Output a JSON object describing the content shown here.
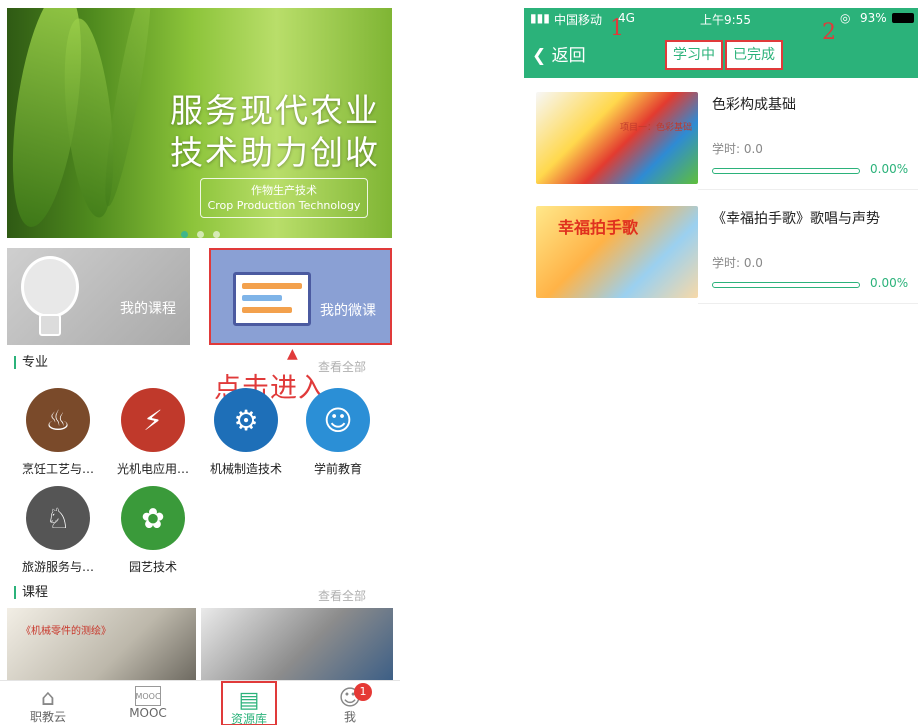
{
  "left_screen": {
    "banner": {
      "headline_line1": "服务现代农业",
      "headline_line2": "技术助力创收",
      "tag_line1": "作物生产技术",
      "tag_line2": "Crop Production Technology"
    },
    "cards": {
      "my_course": "我的课程",
      "my_micro_course": "我的微课"
    },
    "annotation": "点击进入",
    "majors_section": {
      "title": "专业",
      "more": "查看全部",
      "items": [
        {
          "name": "烹饪工艺与…",
          "icon": "culinary-logo-icon",
          "color": "#7a4a2a"
        },
        {
          "name": "光机电应用…",
          "icon": "optomech-logo-icon",
          "color": "#c0392b"
        },
        {
          "name": "机械制造技术",
          "icon": "machinery-logo-icon",
          "color": "#1e6fb8"
        },
        {
          "name": "学前教育",
          "icon": "preschool-logo-icon",
          "color": "#2b8fd6"
        },
        {
          "name": "旅游服务与…",
          "icon": "tourism-logo-icon",
          "color": "#333333"
        },
        {
          "name": "园艺技术",
          "icon": "horticulture-logo-icon",
          "color": "#3a9a3a"
        }
      ]
    },
    "courses_section": {
      "title": "课程",
      "more": "查看全部",
      "thumb1_caption": "《机械零件的测绘》"
    },
    "tabbar": {
      "items": [
        {
          "label": "职教云",
          "icon": "home-icon"
        },
        {
          "label": "MOOC",
          "icon": "mooc-icon"
        },
        {
          "label": "资源库",
          "icon": "resource-library-icon"
        },
        {
          "label": "我",
          "icon": "user-icon"
        }
      ],
      "badge": "1"
    }
  },
  "right_screen": {
    "status_bar": {
      "carrier": "中国移动",
      "network": "4G",
      "time": "上午9:55",
      "battery": "93%"
    },
    "nav": {
      "back": "返回",
      "segment_learning": "学习中",
      "segment_completed": "已完成",
      "marker_1": "1",
      "marker_2": "2"
    },
    "courses": [
      {
        "title": "色彩构成基础",
        "hours": "学时: 0.0",
        "progress": 0.0,
        "progress_text": "0.00%",
        "thumb_caption": "项目一：色彩基础"
      },
      {
        "title": "《幸福拍手歌》歌唱与声势",
        "hours": "学时: 0.0",
        "progress": 0.0,
        "progress_text": "0.00%",
        "thumb_caption": "幸福拍手歌"
      }
    ],
    "colors": {
      "accent": "#2bb27a",
      "annotation": "#e03a3a"
    }
  }
}
